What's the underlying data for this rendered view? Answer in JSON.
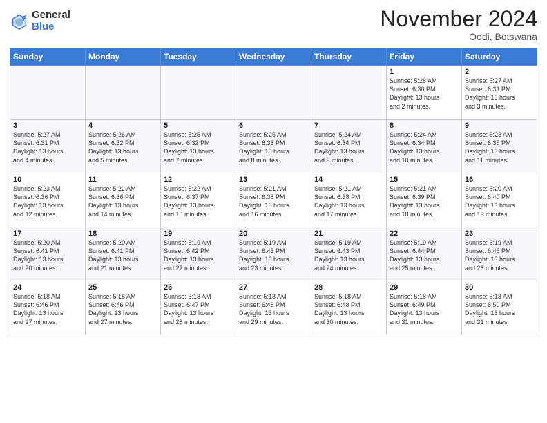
{
  "header": {
    "logo_general": "General",
    "logo_blue": "Blue",
    "title": "November 2024",
    "location": "Oodi, Botswana"
  },
  "weekdays": [
    "Sunday",
    "Monday",
    "Tuesday",
    "Wednesday",
    "Thursday",
    "Friday",
    "Saturday"
  ],
  "weeks": [
    [
      {
        "day": "",
        "info": ""
      },
      {
        "day": "",
        "info": ""
      },
      {
        "day": "",
        "info": ""
      },
      {
        "day": "",
        "info": ""
      },
      {
        "day": "",
        "info": ""
      },
      {
        "day": "1",
        "info": "Sunrise: 5:28 AM\nSunset: 6:30 PM\nDaylight: 13 hours\nand 2 minutes."
      },
      {
        "day": "2",
        "info": "Sunrise: 5:27 AM\nSunset: 6:31 PM\nDaylight: 13 hours\nand 3 minutes."
      }
    ],
    [
      {
        "day": "3",
        "info": "Sunrise: 5:27 AM\nSunset: 6:31 PM\nDaylight: 13 hours\nand 4 minutes."
      },
      {
        "day": "4",
        "info": "Sunrise: 5:26 AM\nSunset: 6:32 PM\nDaylight: 13 hours\nand 5 minutes."
      },
      {
        "day": "5",
        "info": "Sunrise: 5:25 AM\nSunset: 6:32 PM\nDaylight: 13 hours\nand 7 minutes."
      },
      {
        "day": "6",
        "info": "Sunrise: 5:25 AM\nSunset: 6:33 PM\nDaylight: 13 hours\nand 8 minutes."
      },
      {
        "day": "7",
        "info": "Sunrise: 5:24 AM\nSunset: 6:34 PM\nDaylight: 13 hours\nand 9 minutes."
      },
      {
        "day": "8",
        "info": "Sunrise: 5:24 AM\nSunset: 6:34 PM\nDaylight: 13 hours\nand 10 minutes."
      },
      {
        "day": "9",
        "info": "Sunrise: 5:23 AM\nSunset: 6:35 PM\nDaylight: 13 hours\nand 11 minutes."
      }
    ],
    [
      {
        "day": "10",
        "info": "Sunrise: 5:23 AM\nSunset: 6:36 PM\nDaylight: 13 hours\nand 12 minutes."
      },
      {
        "day": "11",
        "info": "Sunrise: 5:22 AM\nSunset: 6:36 PM\nDaylight: 13 hours\nand 14 minutes."
      },
      {
        "day": "12",
        "info": "Sunrise: 5:22 AM\nSunset: 6:37 PM\nDaylight: 13 hours\nand 15 minutes."
      },
      {
        "day": "13",
        "info": "Sunrise: 5:21 AM\nSunset: 6:38 PM\nDaylight: 13 hours\nand 16 minutes."
      },
      {
        "day": "14",
        "info": "Sunrise: 5:21 AM\nSunset: 6:38 PM\nDaylight: 13 hours\nand 17 minutes."
      },
      {
        "day": "15",
        "info": "Sunrise: 5:21 AM\nSunset: 6:39 PM\nDaylight: 13 hours\nand 18 minutes."
      },
      {
        "day": "16",
        "info": "Sunrise: 5:20 AM\nSunset: 6:40 PM\nDaylight: 13 hours\nand 19 minutes."
      }
    ],
    [
      {
        "day": "17",
        "info": "Sunrise: 5:20 AM\nSunset: 6:41 PM\nDaylight: 13 hours\nand 20 minutes."
      },
      {
        "day": "18",
        "info": "Sunrise: 5:20 AM\nSunset: 6:41 PM\nDaylight: 13 hours\nand 21 minutes."
      },
      {
        "day": "19",
        "info": "Sunrise: 5:19 AM\nSunset: 6:42 PM\nDaylight: 13 hours\nand 22 minutes."
      },
      {
        "day": "20",
        "info": "Sunrise: 5:19 AM\nSunset: 6:43 PM\nDaylight: 13 hours\nand 23 minutes."
      },
      {
        "day": "21",
        "info": "Sunrise: 5:19 AM\nSunset: 6:43 PM\nDaylight: 13 hours\nand 24 minutes."
      },
      {
        "day": "22",
        "info": "Sunrise: 5:19 AM\nSunset: 6:44 PM\nDaylight: 13 hours\nand 25 minutes."
      },
      {
        "day": "23",
        "info": "Sunrise: 5:19 AM\nSunset: 6:45 PM\nDaylight: 13 hours\nand 26 minutes."
      }
    ],
    [
      {
        "day": "24",
        "info": "Sunrise: 5:18 AM\nSunset: 6:46 PM\nDaylight: 13 hours\nand 27 minutes."
      },
      {
        "day": "25",
        "info": "Sunrise: 5:18 AM\nSunset: 6:46 PM\nDaylight: 13 hours\nand 27 minutes."
      },
      {
        "day": "26",
        "info": "Sunrise: 5:18 AM\nSunset: 6:47 PM\nDaylight: 13 hours\nand 28 minutes."
      },
      {
        "day": "27",
        "info": "Sunrise: 5:18 AM\nSunset: 6:48 PM\nDaylight: 13 hours\nand 29 minutes."
      },
      {
        "day": "28",
        "info": "Sunrise: 5:18 AM\nSunset: 6:48 PM\nDaylight: 13 hours\nand 30 minutes."
      },
      {
        "day": "29",
        "info": "Sunrise: 5:18 AM\nSunset: 6:49 PM\nDaylight: 13 hours\nand 31 minutes."
      },
      {
        "day": "30",
        "info": "Sunrise: 5:18 AM\nSunset: 6:50 PM\nDaylight: 13 hours\nand 31 minutes."
      }
    ]
  ]
}
